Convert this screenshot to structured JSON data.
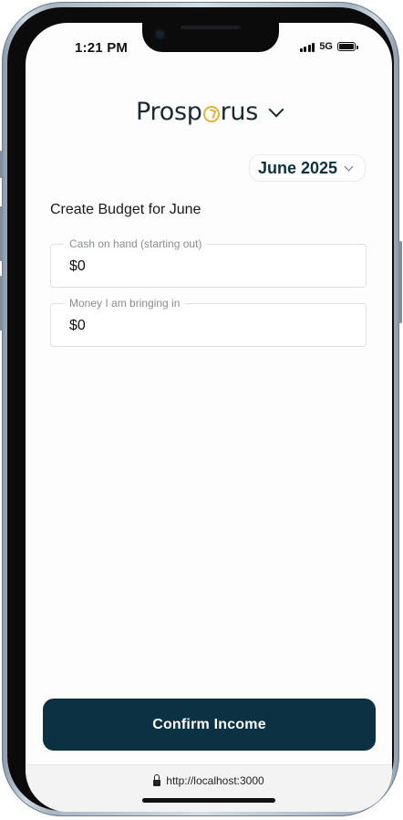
{
  "status_bar": {
    "time": "1:21 PM",
    "network": "5G"
  },
  "brand": {
    "name_prefix": "Prosp",
    "name_suffix": "rus",
    "accent_color": "#e2b23c"
  },
  "month_selector": {
    "value": "June 2025"
  },
  "budget": {
    "title": "Create Budget for June",
    "fields": [
      {
        "label": "Cash on hand (starting out)",
        "value": "$0"
      },
      {
        "label": "Money I am bringing in",
        "value": "$0"
      }
    ]
  },
  "actions": {
    "confirm_label": "Confirm Income",
    "confirm_color": "#0b3142"
  },
  "browser": {
    "url": "http://localhost:3000"
  }
}
